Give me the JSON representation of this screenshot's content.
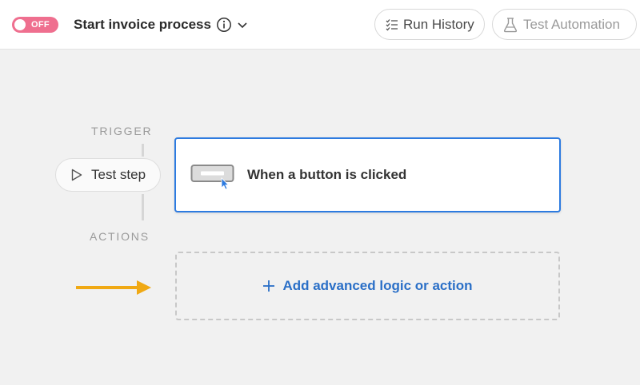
{
  "header": {
    "toggle_label": "OFF",
    "title": "Start invoice process",
    "info_icon": "info-icon",
    "chevron_icon": "chevron-down-icon",
    "run_history_label": "Run History",
    "run_history_icon": "checklist-icon",
    "test_automation_label": "Test Automation",
    "test_automation_icon": "flask-icon"
  },
  "flow": {
    "trigger_label": "TRIGGER",
    "actions_label": "ACTIONS",
    "test_step_label": "Test step",
    "trigger_card_text": "When a button is clicked",
    "trigger_icon": "button-click-icon",
    "add_action_label": "Add advanced logic or action",
    "add_icon": "plus-icon"
  },
  "colors": {
    "toggle_off": "#ef6f8f",
    "accent_blue": "#2d7be0",
    "link_blue": "#2a6fc7",
    "arrow_yellow": "#f0a914"
  }
}
